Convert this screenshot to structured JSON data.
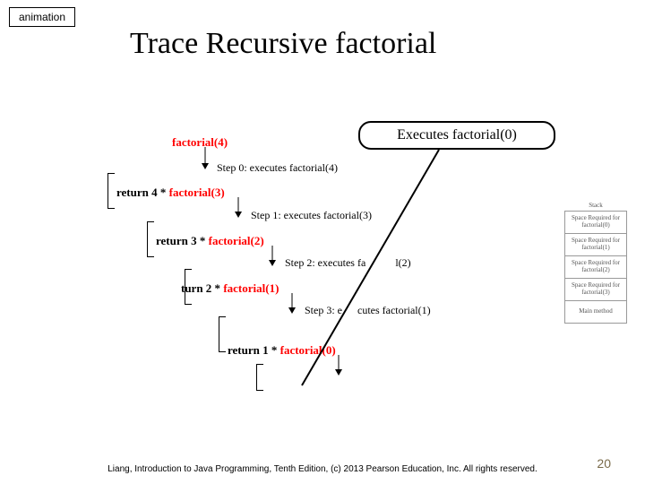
{
  "badge": "animation",
  "title": "Trace Recursive factorial",
  "callout": "Executes factorial(0)",
  "start": {
    "label": "factorial(4)"
  },
  "steps": [
    {
      "step_text": "Step 0: executes factorial(4)",
      "return_prefix": "return 4 * ",
      "return_call": "factorial(3)"
    },
    {
      "step_text": "Step 1: executes factorial(3)",
      "return_prefix": "return 3 * ",
      "return_call": "factorial(2)"
    },
    {
      "step_text": "Step 2: executes fa",
      "step_tail": "l(2)",
      "return_prefix": "turn 2 * ",
      "return_call": "factorial(1)"
    },
    {
      "step_text": "Step 3: e",
      "step_tail": "cutes factorial(1)",
      "return_prefix": "return 1 * ",
      "return_call": "factorial(0)"
    }
  ],
  "stack": {
    "label": "Stack",
    "frames": [
      "Space Required for factorial(0)",
      "Space Required for factorial(1)",
      "Space Required for factorial(2)",
      "Space Required for factorial(3)",
      "Main method"
    ]
  },
  "footer": "Liang, Introduction to Java Programming, Tenth Edition, (c) 2013 Pearson Education, Inc. All rights reserved.",
  "page": "20"
}
